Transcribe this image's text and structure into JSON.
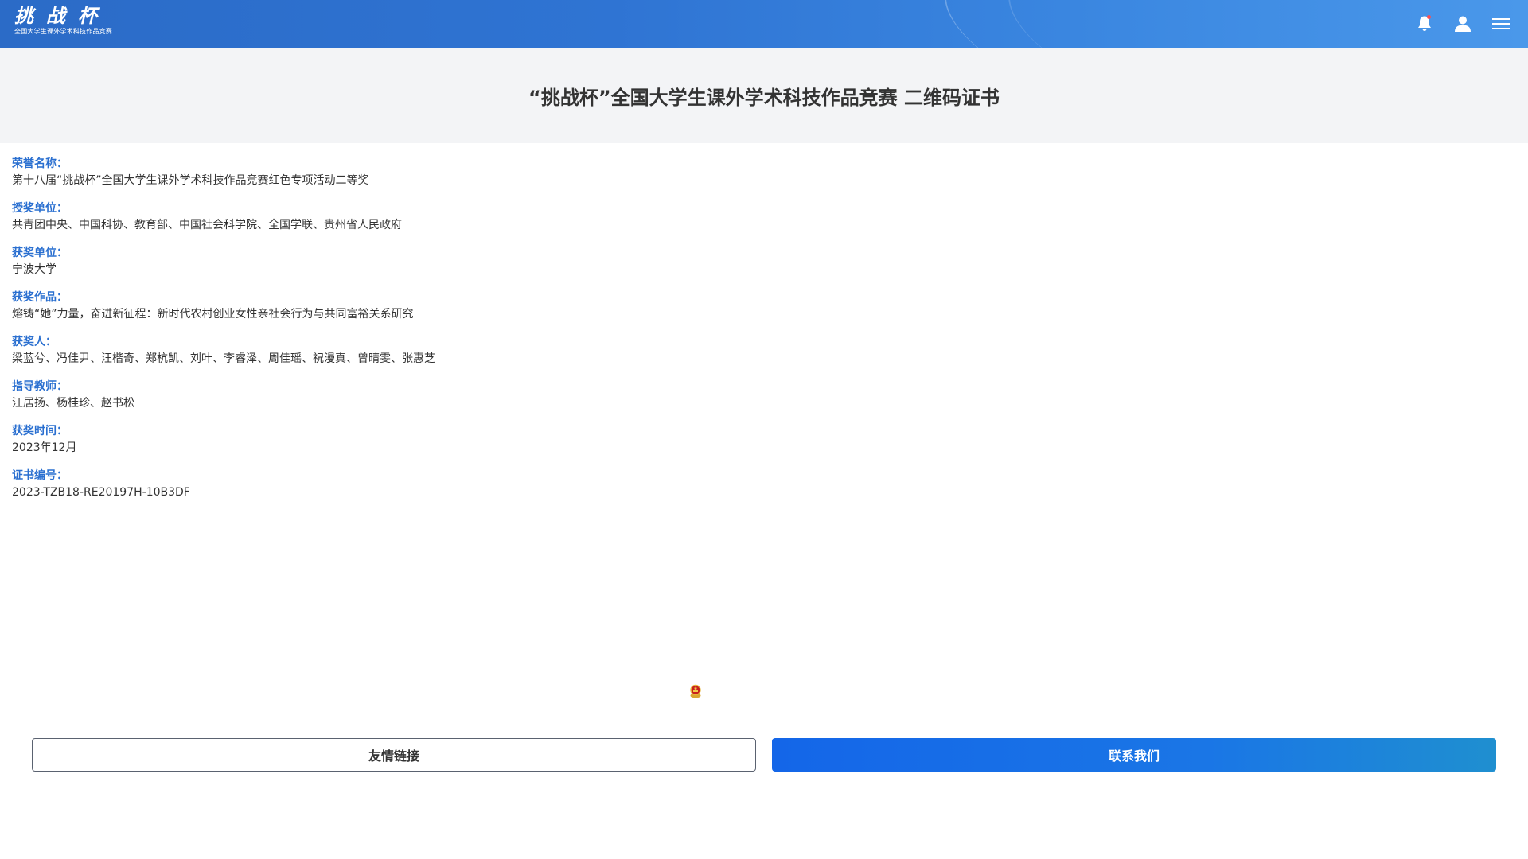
{
  "header": {
    "logo_main": "挑战杯",
    "logo_sub": "全国大学生课外学术科技作品竞赛",
    "icons": [
      "bell-icon",
      "user-icon",
      "menu-icon"
    ],
    "colors": {
      "bar_start": "#2b6bc7",
      "bar_end": "#4a98ea",
      "notification_dot": "#ff4d4f"
    }
  },
  "page": {
    "title": "“挑战杯”全国大学生课外学术科技作品竞赛 二维码证书"
  },
  "certificate": {
    "fields": [
      {
        "label": "荣誉名称：",
        "value": "第十八届“挑战杯”全国大学生课外学术科技作品竞赛红色专项活动二等奖"
      },
      {
        "label": "授奖单位：",
        "value": "共青团中央、中国科协、教育部、中国社会科学院、全国学联、贵州省人民政府"
      },
      {
        "label": "获奖单位：",
        "value": "宁波大学"
      },
      {
        "label": "获奖作品：",
        "value": "熔铸“她”力量，奋进新征程：新时代农村创业女性亲社会行为与共同富裕关系研究"
      },
      {
        "label": "获奖人：",
        "value": "梁蓝兮、冯佳尹、汪楷奇、郑杭凯、刘叶、李睿泽、周佳瑶、祝漫真、曾晴雯、张惠芝"
      },
      {
        "label": "指导教师：",
        "value": "汪居扬、杨桂珍、赵书松"
      },
      {
        "label": "获奖时间：",
        "value": "2023年12月"
      },
      {
        "label": "证书编号：",
        "value": "2023-TZB18-RE20197H-10B3DF"
      }
    ],
    "label_color": "#2a6fd0"
  },
  "footer": {
    "emblem_icon": "national-emblem-icon",
    "links_button": "友情链接",
    "contact_button": "联系我们",
    "contact_color": "#1466e8"
  }
}
